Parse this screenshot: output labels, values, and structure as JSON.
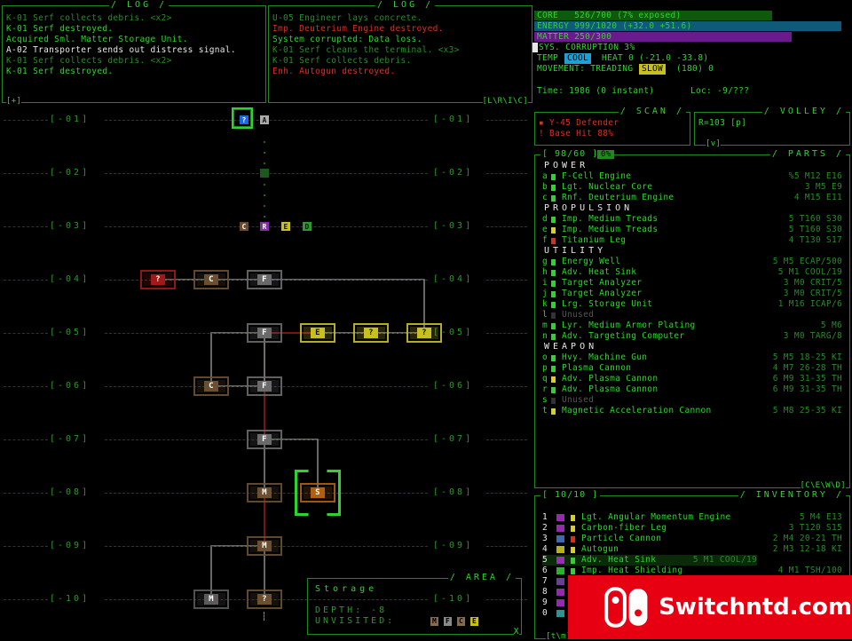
{
  "log_left": {
    "title": "/ LOG /",
    "lines": [
      {
        "text": "K-01 Serf collects debris. <x2>",
        "cls": "dim"
      },
      {
        "text": "K-01 Serf destroyed.",
        "cls": ""
      },
      {
        "text": "Acquired Sml. Matter Storage Unit.",
        "cls": ""
      },
      {
        "text": "A-02 Transporter sends out distress signal.",
        "cls": "white"
      },
      {
        "text": "K-01 Serf collects debris. <x2>",
        "cls": "dim"
      },
      {
        "text": "K-01 Serf destroyed.",
        "cls": ""
      }
    ],
    "corner": "[+]"
  },
  "log_right": {
    "title": "/ LOG /",
    "lines": [
      {
        "text": "U-05 Engineer lays concrete.",
        "cls": "dim"
      },
      {
        "text": "Imp. Deuterium Engine destroyed.",
        "cls": "red"
      },
      {
        "text": "System corrupted: Data loss.",
        "cls": ""
      },
      {
        "text": "K-01 Serf cleans the terminal. <x3>",
        "cls": "dim"
      },
      {
        "text": "K-01 Serf collects debris.",
        "cls": "dim"
      },
      {
        "text": "Enh. Autogun destroyed.",
        "cls": "red"
      }
    ],
    "corner": "[L\\R\\I\\C]"
  },
  "status": {
    "core": "CORE   526/700 (7% exposed)",
    "energy": "ENERGY 999/1020 (+32.0 +51.6)",
    "matter": "MATTER 250/300",
    "sys": "SYS. CORRUPTION 3%",
    "temp_label": "TEMP",
    "temp_badge": "COOL",
    "temp_rest": "HEAT 0 (-21.0 -33.8)",
    "move_label": "MOVEMENT: TREADING",
    "move_badge": "SLOW",
    "move_rest": "(180) 0",
    "time": "Time: 1986 (0 instant)",
    "loc": "Loc: -9/???",
    "colors": {
      "core": "#0d5a0d",
      "energy": "#0e5a78",
      "matter": "#6a1a8a"
    }
  },
  "scan": {
    "title": "/ SCAN /",
    "line1": "Y-45 Defender",
    "line2": "Base Hit 88%"
  },
  "volley": {
    "title": "/ VOLLEY /",
    "line1": "R=103 [p]",
    "corner": "[v]"
  },
  "parts": {
    "title": "/ PARTS /",
    "count": "[ 98/60 ]",
    "badge": "0%",
    "corner": "[C\\E\\W\\D]",
    "categories": [
      {
        "name": "Power",
        "items": [
          {
            "key": "a",
            "color": "#2fd32f",
            "name": "F-Cell Engine",
            "stat": "%5 M12 E16"
          },
          {
            "key": "b",
            "color": "#2fd32f",
            "name": "Lgt. Nuclear Core",
            "stat": "3 M5 E9"
          },
          {
            "key": "c",
            "color": "#2fd32f",
            "name": "Rnf. Deuterium Engine",
            "stat": "4 M15 E11"
          }
        ]
      },
      {
        "name": "Propulsion",
        "items": [
          {
            "key": "d",
            "color": "#2fd32f",
            "name": "Imp. Medium Treads",
            "stat": "5 T160 S30"
          },
          {
            "key": "e",
            "color": "#d8d020",
            "name": "Imp. Medium Treads",
            "stat": "5 T160 S30"
          },
          {
            "key": "f",
            "color": "#d83020",
            "name": "Titanium Leg",
            "stat": "4 T130 S17"
          }
        ]
      },
      {
        "name": "Utility",
        "items": [
          {
            "key": "g",
            "color": "#2fd32f",
            "name": "Energy Well",
            "stat": "5 M5 ECAP/500"
          },
          {
            "key": "h",
            "color": "#2fd32f",
            "name": "Adv. Heat Sink",
            "stat": "5 M1 COOL/19"
          },
          {
            "key": "i",
            "color": "#2fd32f",
            "name": "Target Analyzer",
            "stat": "3 M0 CRIT/5"
          },
          {
            "key": "j",
            "color": "#2fd32f",
            "name": "Target Analyzer",
            "stat": "3 M0 CRIT/5"
          },
          {
            "key": "k",
            "color": "#2fd32f",
            "name": "Lrg. Storage Unit",
            "stat": "1 M16 ICAP/6"
          },
          {
            "key": "l",
            "color": "#333333",
            "name": "Unused",
            "stat": ""
          },
          {
            "key": "m",
            "color": "#2fd32f",
            "name": "Lyr. Medium Armor Plating",
            "stat": "5 M6"
          },
          {
            "key": "n",
            "color": "#2fd32f",
            "name": "Adv. Targeting Computer",
            "stat": "3 M0 TARG/8"
          }
        ]
      },
      {
        "name": "Weapon",
        "items": [
          {
            "key": "o",
            "color": "#2fd32f",
            "name": "Hvy. Machine Gun",
            "stat": "5 M5 18-25 KI"
          },
          {
            "key": "p",
            "color": "#2fd32f",
            "name": "Plasma Cannon",
            "stat": "4 M7 26-28 TH"
          },
          {
            "key": "q",
            "color": "#d8d020",
            "name": "Adv. Plasma Cannon",
            "stat": "6 M9 31-35 TH"
          },
          {
            "key": "r",
            "color": "#2fd32f",
            "name": "Adv. Plasma Cannon",
            "stat": "6 M9 31-35 TH"
          },
          {
            "key": "s",
            "color": "#333333",
            "name": "Unused",
            "stat": ""
          },
          {
            "key": "t",
            "color": "#d8d020",
            "name": "Magnetic Acceleration Cannon",
            "stat": "5 M8 25-35 KI"
          }
        ]
      }
    ]
  },
  "inventory": {
    "title": "/ INVENTORY /",
    "count": "[ 10/10 ]",
    "items": [
      {
        "num": "1",
        "color": "#d8d020",
        "name": "Lgt. Angular Momentum Engine",
        "stat": "5 M4 E13"
      },
      {
        "num": "2",
        "color": "#d8d020",
        "name": "Carbon-fiber Leg",
        "stat": "3 T120 S15"
      },
      {
        "num": "3",
        "color": "#d83020",
        "name": "Particle Cannon",
        "stat": "2 M4 20-21 TH"
      },
      {
        "num": "4",
        "color": "#d8d020",
        "name": "Autogun",
        "stat": "2 M3 12-18 KI"
      },
      {
        "num": "5",
        "color": "#2fd32f",
        "name": "Adv. Heat Sink",
        "stat": "5 M1 COOL/19"
      },
      {
        "num": "6",
        "color": "#2fd32f",
        "name": "Imp. Heat Shielding",
        "stat": "4 M1 TSH/100"
      },
      {
        "num": "7",
        "color": "#2fd32f",
        "name": "",
        "stat": ""
      },
      {
        "num": "8",
        "color": "#2fd32f",
        "name": "",
        "stat": ""
      },
      {
        "num": "9",
        "color": "#2fd32f",
        "name": "",
        "stat": ""
      },
      {
        "num": "0",
        "color": "#2fd32f",
        "name": "",
        "stat": ""
      }
    ],
    "corner": "[t\\m]"
  },
  "map": {
    "depths": [
      "[-01]",
      "[-02]",
      "[-03]",
      "[-04]",
      "[-05]",
      "[-06]",
      "[-07]",
      "[-08]",
      "[-09]",
      "[-10]"
    ],
    "nodes": [
      {
        "label": "?",
        "color": "#1a6adf",
        "text": "#fff"
      },
      {
        "label": "A",
        "color": "#aaaaaa",
        "text": "#111"
      },
      {
        "label": "C",
        "color": "#6a4a2a",
        "text": "#fff"
      },
      {
        "label": "R",
        "color": "#8a2aaf",
        "text": "#fff"
      },
      {
        "label": "E",
        "color": "#c8c020",
        "text": "#111"
      },
      {
        "label": "D",
        "color": "#2a9a2a",
        "text": "#111"
      },
      {
        "label": "?",
        "color": "#a01a1a",
        "text": "#fff"
      },
      {
        "label": "C",
        "color": "#6a5030",
        "text": "#fff"
      },
      {
        "label": "F",
        "color": "#6a6a6a",
        "text": "#fff"
      },
      {
        "label": "F",
        "color": "#6a6a6a",
        "text": "#fff"
      },
      {
        "label": "E",
        "color": "#c8c020",
        "text": "#111"
      },
      {
        "label": "?",
        "color": "#c8c020",
        "text": "#111"
      },
      {
        "label": "?",
        "color": "#c8c020",
        "text": "#111"
      },
      {
        "label": "C",
        "color": "#6a5030",
        "text": "#fff"
      },
      {
        "label": "F",
        "color": "#6a6a6a",
        "text": "#fff"
      },
      {
        "label": "F",
        "color": "#6a6a6a",
        "text": "#fff"
      },
      {
        "label": "M",
        "color": "#6a5030",
        "text": "#fff"
      },
      {
        "label": "S",
        "color": "#b06010",
        "text": "#fff"
      },
      {
        "label": "M",
        "color": "#6a5030",
        "text": "#fff"
      },
      {
        "label": "M",
        "color": "#5a5a5a",
        "text": "#fff"
      },
      {
        "label": "?",
        "color": "#6a5030",
        "text": "#fff"
      }
    ]
  },
  "area": {
    "title": "/ AREA /",
    "name": "Storage",
    "depth": "DEPTH: -8",
    "unvisited": "UNVISITED:",
    "unvisited_tags": [
      {
        "label": "M",
        "color": "#8a6a4a"
      },
      {
        "label": "F",
        "color": "#8a8a8a"
      },
      {
        "label": "C",
        "color": "#8a6a4a"
      },
      {
        "label": "E",
        "color": "#c8c020"
      }
    ],
    "corner": "X"
  },
  "logo": {
    "text": "Switchntd.com"
  }
}
